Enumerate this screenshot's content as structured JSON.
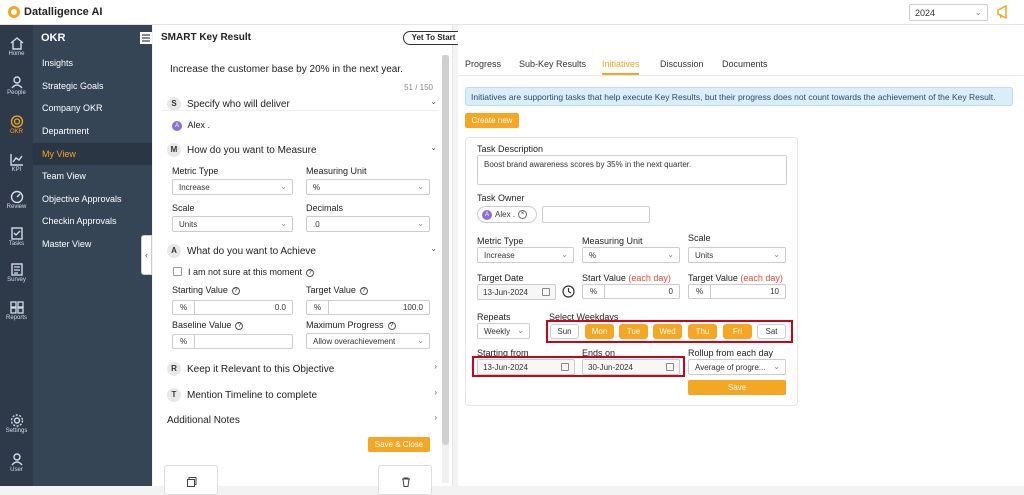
{
  "app": {
    "brand": "Datalligence AI",
    "year": "2024"
  },
  "rail": [
    {
      "label": "Home",
      "icon": "home-icon"
    },
    {
      "label": "People",
      "icon": "people-icon"
    },
    {
      "label": "OKR",
      "icon": "target-icon"
    },
    {
      "label": "KPI",
      "icon": "chart-icon"
    },
    {
      "label": "Review",
      "icon": "gauge-icon"
    },
    {
      "label": "Tasks",
      "icon": "tasks-icon"
    },
    {
      "label": "Survey",
      "icon": "survey-icon"
    },
    {
      "label": "Reports",
      "icon": "reports-icon"
    },
    {
      "label": "Settings",
      "icon": "settings-icon"
    },
    {
      "label": "User",
      "icon": "user-icon"
    }
  ],
  "menu": {
    "title": "OKR",
    "items": [
      "Insights",
      "Strategic Goals",
      "Company OKR",
      "Department",
      "My View",
      "Team View",
      "Objective Approvals",
      "Checkin Approvals",
      "Master View"
    ]
  },
  "left": {
    "title": "SMART Key Result",
    "status": "Yet To Start",
    "kr_text": "Increase the customer base by 20% in the next year.",
    "kr_count": "51 / 150",
    "s_badge": "S",
    "s_title": "Specify who will deliver",
    "owner_initial": "A",
    "owner_name": "Alex .",
    "m_badge": "M",
    "m_title": "How do you want to Measure",
    "metric_type_label": "Metric Type",
    "metric_type_value": "Increase",
    "measuring_unit_label": "Measuring Unit",
    "measuring_unit_value": "%",
    "scale_label": "Scale",
    "scale_value": "Units",
    "decimals_label": "Decimals",
    "decimals_value": ".0",
    "a_badge": "A",
    "a_title": "What do you want to Achieve",
    "not_sure": "I am not sure at this moment",
    "starting_label": "Starting Value",
    "starting_prefix": "%",
    "starting_value": "0.0",
    "target_label": "Target Value",
    "target_prefix": "%",
    "target_value": "100.0",
    "baseline_label": "Baseline Value",
    "baseline_prefix": "%",
    "max_progress_label": "Maximum Progress",
    "max_progress_value": "Allow overachievement",
    "r_badge": "R",
    "r_title": "Keep it Relevant to this Objective",
    "t_badge": "T",
    "t_title": "Mention Timeline to complete",
    "notes_title": "Additional Notes",
    "save_close": "Save & Close"
  },
  "right": {
    "tabs": [
      "Progress",
      "Sub-Key Results",
      "Initiatives",
      "Discussion",
      "Documents"
    ],
    "info": "Initiatives are supporting tasks that help execute Key Results, but their progress does not count towards the achievement of the Key Result.",
    "create_new": "Create new",
    "task_desc_label": "Task Description",
    "task_desc_value": "Boost brand awareness scores by 35% in the next quarter.",
    "task_owner_label": "Task Owner",
    "owner_initial": "A",
    "owner_name": "Alex .",
    "metric_type_label": "Metric Type",
    "metric_type_value": "Increase",
    "measuring_unit_label": "Measuring Unit",
    "measuring_unit_value": "%",
    "scale_label": "Scale",
    "scale_value": "Units",
    "target_date_label": "Target Date",
    "target_date_value": "13-Jun-2024",
    "start_value_label": "Start Value",
    "start_value_hint": "(each day)",
    "start_prefix": "%",
    "start_value": "0",
    "target_value_label": "Target Value",
    "target_value_hint": "(each day)",
    "target_prefix": "%",
    "target_value": "10",
    "repeats_label": "Repeats",
    "repeats_value": "Weekly",
    "weekdays_label": "Select Weekdays",
    "weekdays": [
      {
        "d": "Sun",
        "on": false
      },
      {
        "d": "Mon",
        "on": true
      },
      {
        "d": "Tue",
        "on": true
      },
      {
        "d": "Wed",
        "on": true
      },
      {
        "d": "Thu",
        "on": true
      },
      {
        "d": "Fri",
        "on": true
      },
      {
        "d": "Sat",
        "on": false
      }
    ],
    "starting_from_label": "Starting from",
    "starting_from_value": "13-Jun-2024",
    "ends_on_label": "Ends on",
    "ends_on_value": "30-Jun-2024",
    "rollup_label": "Rollup from each day",
    "rollup_value": "Average of progre...",
    "save": "Save"
  },
  "colors": {
    "accent": "#f5a623",
    "sidebar": "#2e3a4a",
    "menu": "#364556",
    "highlight": "#d0021b"
  }
}
